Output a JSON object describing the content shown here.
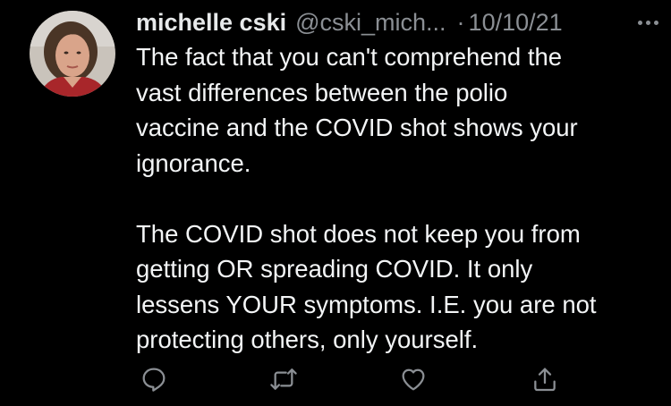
{
  "tweet": {
    "author": {
      "name": "michelle cski",
      "handle": "@cski_mich...",
      "separator": "·",
      "date": "10/10/21"
    },
    "paragraphs": [
      [
        "The fact that you can't comprehend the",
        "vast differences between the polio",
        "vaccine and the COVID shot shows your",
        "ignorance."
      ],
      [
        "The COVID shot does not keep you from",
        "getting OR spreading COVID.  It only",
        "lessens YOUR symptoms.  I.E. you are not",
        "protecting others, only yourself."
      ]
    ]
  },
  "actions": [
    {
      "name": "reply",
      "icon": "reply-icon"
    },
    {
      "name": "retweet",
      "icon": "retweet-icon"
    },
    {
      "name": "like",
      "icon": "heart-icon"
    },
    {
      "name": "share",
      "icon": "share-icon"
    }
  ],
  "colors": {
    "background": "#000000",
    "text": "#e7e9ea",
    "muted": "#8b8f94"
  }
}
